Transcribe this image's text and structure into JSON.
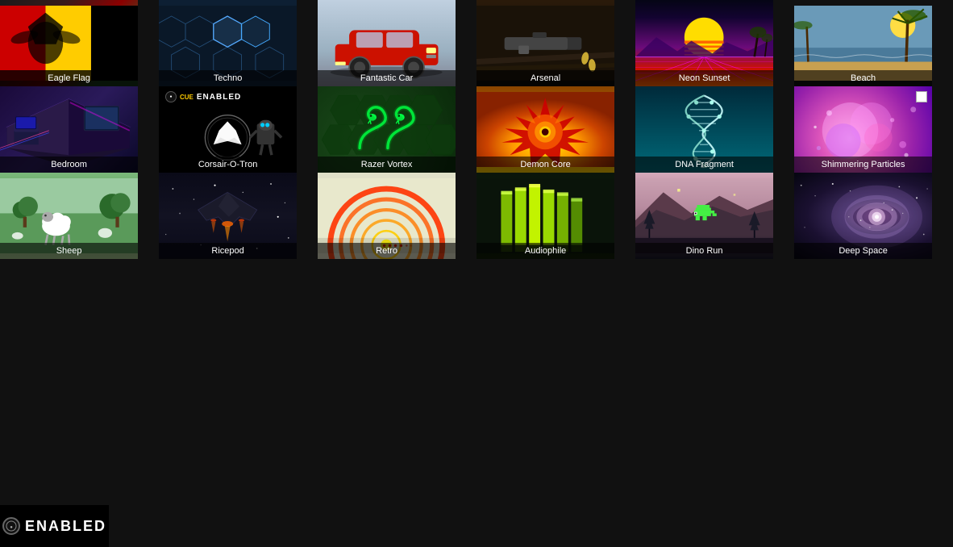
{
  "tiles": [
    {
      "id": "eagle-flag",
      "label": "Eagle Flag",
      "row": 1,
      "col": 1,
      "style": "eagle-flag-bg"
    },
    {
      "id": "techno",
      "label": "Techno",
      "row": 1,
      "col": 2,
      "style": "tile-techno"
    },
    {
      "id": "fantastic-car",
      "label": "Fantastic Car",
      "row": 1,
      "col": 3,
      "style": "fantastic-car-bg"
    },
    {
      "id": "arsenal",
      "label": "Arsenal",
      "row": 1,
      "col": 4,
      "style": "arsenal-bg"
    },
    {
      "id": "neon-sunset",
      "label": "Neon Sunset",
      "row": 1,
      "col": 5,
      "style": "tile-neon-sunset"
    },
    {
      "id": "beach",
      "label": "Beach",
      "row": 1,
      "col": 6,
      "style": "beach-bg"
    },
    {
      "id": "bedroom",
      "label": "Bedroom",
      "row": 2,
      "col": 1,
      "style": "bedroom-bg"
    },
    {
      "id": "corsair-o-tron",
      "label": "Corsair-O-Tron",
      "row": 2,
      "col": 2,
      "style": "tile-corsair"
    },
    {
      "id": "razer-vortex",
      "label": "Razer Vortex",
      "row": 2,
      "col": 3,
      "style": "razer-snake-bg"
    },
    {
      "id": "demon-core",
      "label": "Demon Core",
      "row": 2,
      "col": 4,
      "style": "demon-core-bg"
    },
    {
      "id": "dna-fragment",
      "label": "DNA Fragment",
      "row": 2,
      "col": 5,
      "style": "dna-bg"
    },
    {
      "id": "shimmering-particles",
      "label": "Shimmering Particles",
      "row": 2,
      "col": 6,
      "style": "shimmer-bg"
    },
    {
      "id": "sheep",
      "label": "Sheep",
      "row": 3,
      "col": 1,
      "style": "sheep-bg"
    },
    {
      "id": "ricepod",
      "label": "Ricepod",
      "row": 3,
      "col": 2,
      "style": "ricepod-bg"
    },
    {
      "id": "retro",
      "label": "Retro",
      "row": 3,
      "col": 3,
      "style": "retro-bg"
    },
    {
      "id": "audiophile",
      "label": "Audiophile",
      "row": 3,
      "col": 4,
      "style": "audiophile-bg"
    },
    {
      "id": "dino-run",
      "label": "Dino Run",
      "row": 3,
      "col": 5,
      "style": "dino-run-bg"
    },
    {
      "id": "deep-space",
      "label": "Deep Space",
      "row": 3,
      "col": 6,
      "style": "deep-space-bg"
    }
  ],
  "bottom_bar": {
    "enabled_label": "ENABLED"
  }
}
